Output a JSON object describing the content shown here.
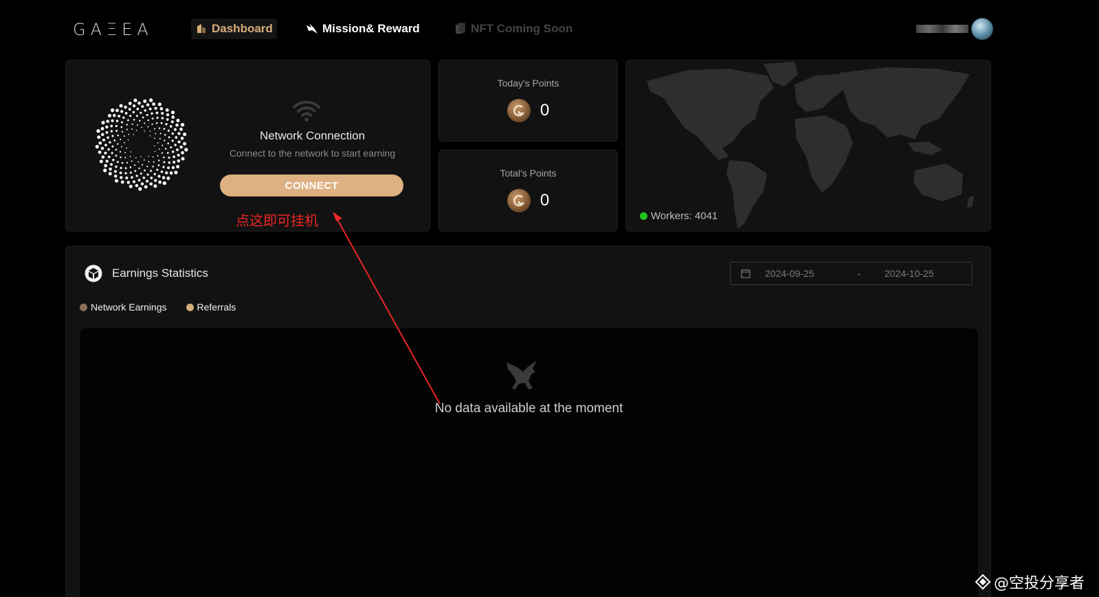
{
  "brand": {
    "logo_text": "GAΞEA"
  },
  "nav": {
    "items": [
      {
        "label": "Dashboard",
        "icon": "dashboard-icon",
        "active": true
      },
      {
        "label": "Mission& Reward",
        "icon": "mission-icon",
        "active": false
      },
      {
        "label": "NFT Coming Soon",
        "icon": "nft-icon",
        "active": false
      }
    ]
  },
  "connection": {
    "title": "Network Connection",
    "subtitle": "Connect to the network to start earning",
    "button_label": "CONNECT"
  },
  "points": {
    "today": {
      "label": "Today's Points",
      "value": "0"
    },
    "total": {
      "label": "Total's Points",
      "value": "0"
    }
  },
  "map": {
    "workers_label": "Workers: 4041",
    "status_color": "#1ec51e"
  },
  "earnings": {
    "title": "Earnings Statistics",
    "date_from": "2024-09-25",
    "date_separator": "-",
    "date_to": "2024-10-25",
    "legend": [
      {
        "label": "Network Earnings",
        "color": "#8a7058"
      },
      {
        "label": "Referrals",
        "color": "#d7ae7a"
      }
    ],
    "empty_message": "No data available at the moment"
  },
  "annotation": {
    "text": "点这即可挂机",
    "color": "#ec2525"
  },
  "watermark": {
    "text": "@空投分享者"
  },
  "colors": {
    "accent": "#deb182",
    "background": "#000000",
    "card": "#121212"
  }
}
